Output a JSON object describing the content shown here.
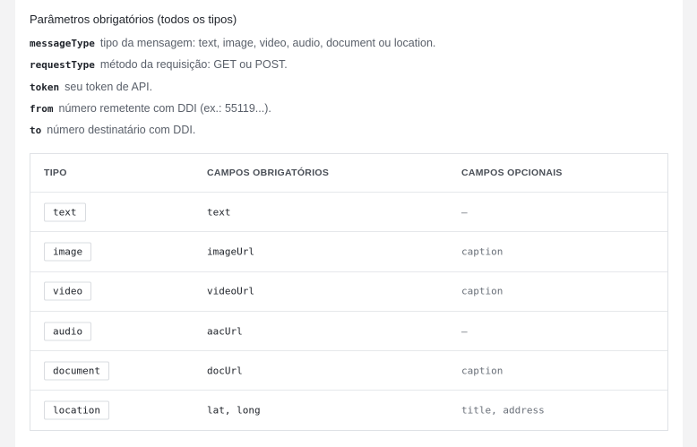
{
  "heading": "Parâmetros obrigatórios (todos os tipos)",
  "params": [
    {
      "name": "messageType",
      "desc": "tipo da mensagem: text, image, video, audio, document ou location."
    },
    {
      "name": "requestType",
      "desc": "método da requisição: GET ou POST."
    },
    {
      "name": "token",
      "desc": "seu token de API."
    },
    {
      "name": "from",
      "desc": "número remetente com DDI (ex.: 55119...)."
    },
    {
      "name": "to",
      "desc": "número destinatário com DDI."
    }
  ],
  "table": {
    "headers": [
      "TIPO",
      "CAMPOS OBRIGATÓRIOS",
      "CAMPOS OPCIONAIS"
    ],
    "rows": [
      {
        "type": "text",
        "required": "text",
        "optional": "—"
      },
      {
        "type": "image",
        "required": "imageUrl",
        "optional": "caption"
      },
      {
        "type": "video",
        "required": "videoUrl",
        "optional": "caption"
      },
      {
        "type": "audio",
        "required": "aacUrl",
        "optional": "—"
      },
      {
        "type": "document",
        "required": "docUrl",
        "optional": "caption"
      },
      {
        "type": "location",
        "required": "lat, long",
        "optional": "title, address"
      }
    ]
  }
}
